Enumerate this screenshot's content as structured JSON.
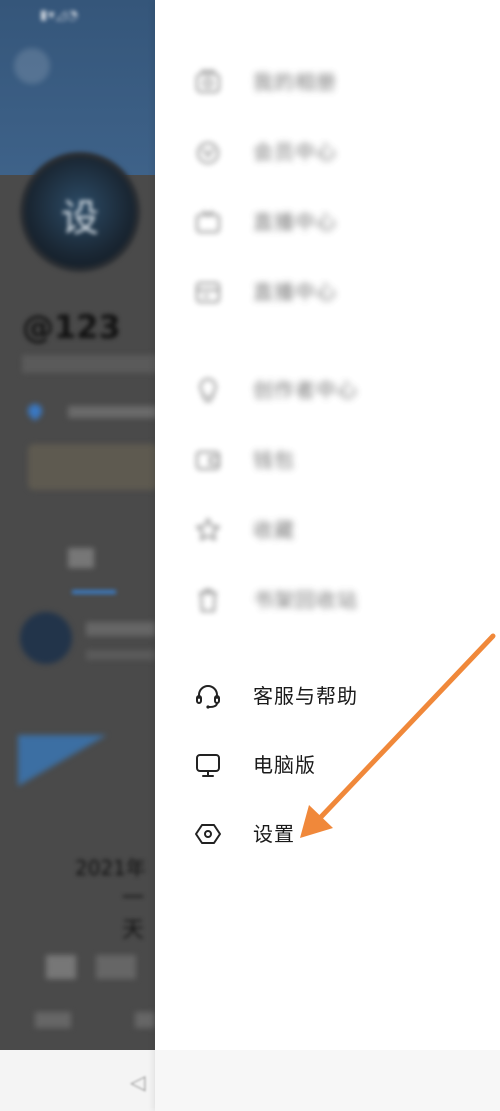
{
  "background_page": {
    "avatar_text": "设",
    "username": "@123",
    "year_text": "2021年",
    "line_text": "一天"
  },
  "drawer": {
    "blurred_items": [
      {
        "label": "我的相册",
        "icon": "album-icon"
      },
      {
        "label": "会员中心",
        "icon": "vip-icon"
      },
      {
        "label": "直播中心",
        "icon": "live-icon"
      },
      {
        "label": "直播中心",
        "icon": "card-icon"
      },
      {
        "label": "创作者中心",
        "icon": "bulb-icon"
      },
      {
        "label": "钱包",
        "icon": "wallet-icon"
      },
      {
        "label": "收藏",
        "icon": "star-icon"
      },
      {
        "label": "书架回收站",
        "icon": "trash-icon"
      }
    ],
    "items": [
      {
        "label": "客服与帮助",
        "icon": "headset-icon"
      },
      {
        "label": "电脑版",
        "icon": "monitor-icon"
      },
      {
        "label": "设置",
        "icon": "settings-icon"
      }
    ]
  },
  "colors": {
    "annotation_arrow": "#f0883a",
    "header_blue": "#3a5c80",
    "overlay_gray": "#4a4a4a",
    "drawer_bg": "#ffffff"
  }
}
